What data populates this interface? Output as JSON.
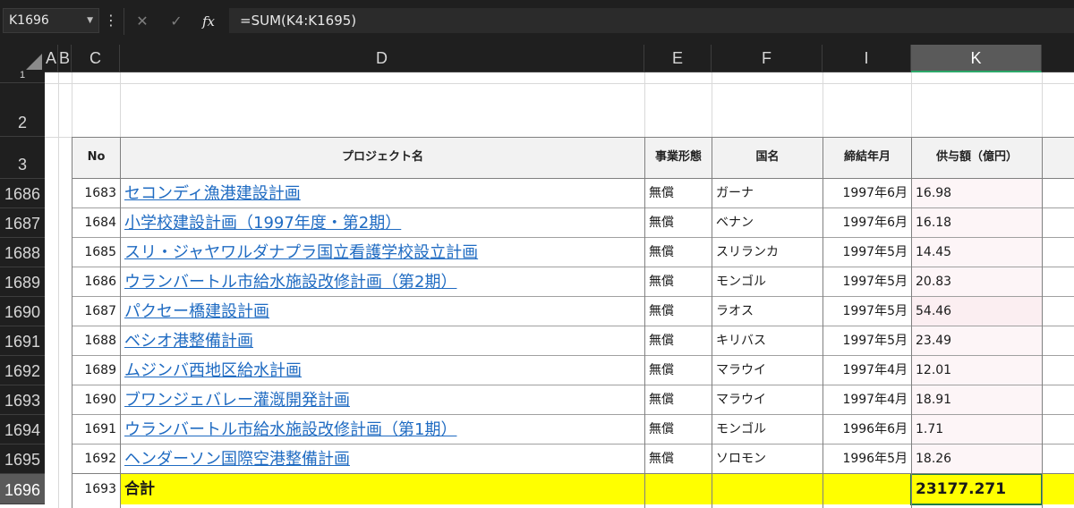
{
  "formula_bar": {
    "name_box": "K1696",
    "formula": "=SUM(K4:K1695)",
    "cancel_icon": "✕",
    "enter_icon": "✓",
    "fx_label": "fx",
    "more_icon": "⋮"
  },
  "columns": [
    "A",
    "B",
    "C",
    "D",
    "E",
    "F",
    "I",
    "K"
  ],
  "selected_column": "K",
  "row_headers": [
    "1",
    "2",
    "3",
    "1686",
    "1687",
    "1688",
    "1689",
    "1690",
    "1691",
    "1692",
    "1693",
    "1694",
    "1695",
    "1696"
  ],
  "selected_row": "1696",
  "table": {
    "headers": {
      "no": "No",
      "project": "プロジェクト名",
      "type": "事業形態",
      "country": "国名",
      "date": "締結年月",
      "amount": "供与額（億円）"
    },
    "rows": [
      {
        "no": "1683",
        "project": "セコンディ漁港建設計画",
        "type": "無償",
        "country": "ガーナ",
        "date": "1997年6月",
        "amount": "16.98"
      },
      {
        "no": "1684",
        "project": "小学校建設計画（1997年度・第2期）",
        "type": "無償",
        "country": "ベナン",
        "date": "1997年6月",
        "amount": "16.18"
      },
      {
        "no": "1685",
        "project": "スリ・ジャヤワルダナプラ国立看護学校設立計画",
        "type": "無償",
        "country": "スリランカ",
        "date": "1997年5月",
        "amount": "14.45"
      },
      {
        "no": "1686",
        "project": "ウランバートル市給水施設改修計画（第2期）",
        "type": "無償",
        "country": "モンゴル",
        "date": "1997年5月",
        "amount": "20.83"
      },
      {
        "no": "1687",
        "project": "パクセー橋建設計画",
        "type": "無償",
        "country": "ラオス",
        "date": "1997年5月",
        "amount": "54.46"
      },
      {
        "no": "1688",
        "project": "ベシオ港整備計画",
        "type": "無償",
        "country": "キリバス",
        "date": "1997年5月",
        "amount": "23.49"
      },
      {
        "no": "1689",
        "project": "ムジンバ西地区給水計画",
        "type": "無償",
        "country": "マラウイ",
        "date": "1997年4月",
        "amount": "12.01"
      },
      {
        "no": "1690",
        "project": "ブワンジェバレー灌漑開発計画",
        "type": "無償",
        "country": "マラウイ",
        "date": "1997年4月",
        "amount": "18.91"
      },
      {
        "no": "1691",
        "project": "ウランバートル市給水施設改修計画（第1期）",
        "type": "無償",
        "country": "モンゴル",
        "date": "1996年6月",
        "amount": "1.71"
      },
      {
        "no": "1692",
        "project": "ヘンダーソン国際空港整備計画",
        "type": "無償",
        "country": "ソロモン",
        "date": "1996年5月",
        "amount": "18.26"
      }
    ],
    "total": {
      "no": "1693",
      "label": "合計",
      "amount": "23177.271"
    }
  },
  "colors": {
    "grid_header_bg": "#1f1f1f",
    "link": "#1f6bc2",
    "total_highlight": "#ffff00",
    "selection": "#1e7d45"
  }
}
